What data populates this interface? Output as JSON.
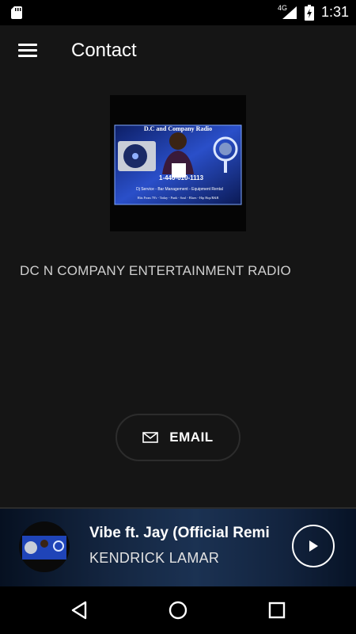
{
  "status_bar": {
    "network": "4G",
    "time": "1:31",
    "icons": [
      "sd-card-icon",
      "signal-icon",
      "battery-icon"
    ]
  },
  "app_bar": {
    "title": "Contact",
    "menu_icon": "hamburger-menu-icon"
  },
  "station": {
    "logo_text": {
      "heading": "D.C and Company Radio",
      "name": "D.C",
      "phone": "1-440-610-1113",
      "services": "Dj Service - Bar Management - Equipment Rental",
      "tagline": "Hits From 70's - Today - Punk - Soul - Blues - Hip Hop/R&B"
    },
    "name": "DC N COMPANY ENTERTAINMENT RADIO"
  },
  "email_button": {
    "label": "EMAIL",
    "icon": "envelope-icon"
  },
  "player": {
    "track_title": "Vibe ft. Jay (Official Remi",
    "artist": "KENDRICK LAMAR",
    "play_icon": "play-icon"
  },
  "nav_bar": {
    "icons": [
      "back-icon",
      "home-icon",
      "recents-icon"
    ]
  },
  "colors": {
    "background": "#151515",
    "status_bar": "#000000",
    "button_border": "#2c2c2c",
    "player_accent": "#2a4d7f"
  }
}
